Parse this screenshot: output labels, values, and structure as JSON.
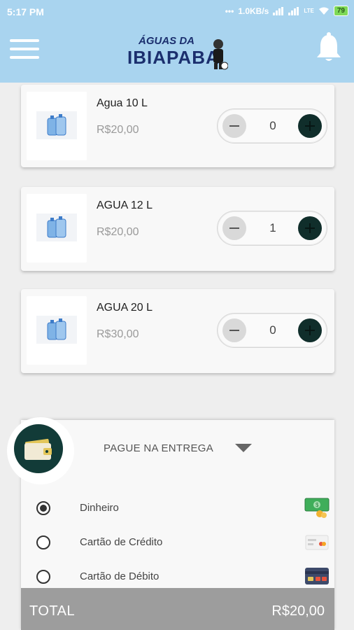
{
  "status_bar": {
    "time": "5:17 PM",
    "network_speed": "1.0KB/s",
    "network_type": "LTE",
    "battery": "79"
  },
  "header": {
    "logo_line1": "ÁGUAS DA",
    "logo_line2": "IBIAPABA",
    "brand_color": "#a9d4ef"
  },
  "products": [
    {
      "name": "Agua 10 L",
      "price": "R$20,00",
      "quantity": "0",
      "image_icon": "water-jug-icon"
    },
    {
      "name": "AGUA 12 L",
      "price": "R$20,00",
      "quantity": "1",
      "image_icon": "water-jug-icon"
    },
    {
      "name": "AGUA 20 L",
      "price": "R$30,00",
      "quantity": "0",
      "image_icon": "water-jug-icon"
    }
  ],
  "payment": {
    "mode_label": "PAGUE NA ENTREGA",
    "wallet_icon": "wallet-icon",
    "options": [
      {
        "label": "Dinheiro",
        "selected": true,
        "icon": "cash-icon"
      },
      {
        "label": "Cartão de Crédito",
        "selected": false,
        "icon": "credit-card-icon"
      },
      {
        "label": "Cartão de Débito",
        "selected": false,
        "icon": "debit-card-icon"
      }
    ]
  },
  "total": {
    "label": "TOTAL",
    "value": "R$20,00"
  },
  "colors": {
    "header_bg": "#a9d4ef",
    "accent_dark": "#123b38",
    "total_bar": "#9d9d9d"
  }
}
